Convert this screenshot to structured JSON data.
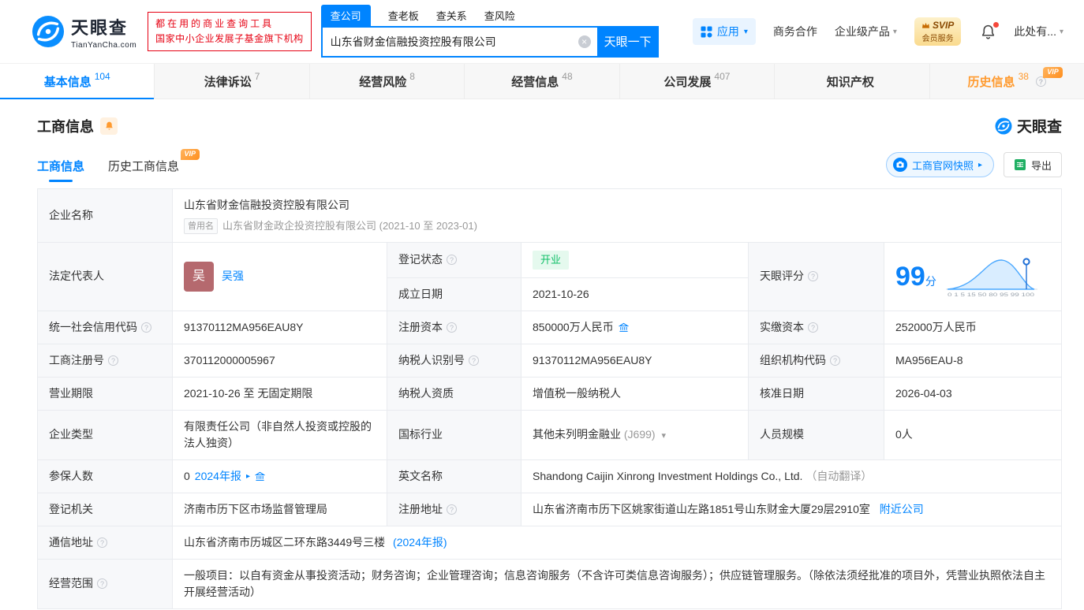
{
  "colors": {
    "brand": "#0084ff",
    "vip_orange": "#ff9a2e",
    "status_green": "#0fbf67",
    "status_green_bg": "#e5f9ee",
    "slogan_red": "#e60012",
    "avatar_bg": "#b5696e",
    "label_bg": "#f7f8fa",
    "table_border": "#e9ebef"
  },
  "icons": {
    "caret_down": "▾",
    "arrow_right": "▸",
    "clear": "×",
    "help": "?"
  },
  "header": {
    "logo_title": "天眼查",
    "logo_subtitle": "TianYanCha.com",
    "slogan_line1": "都在用的商业查询工具",
    "slogan_line2": "国家中小企业发展子基金旗下机构",
    "search_tabs": [
      {
        "label": "查公司"
      },
      {
        "label": "查老板"
      },
      {
        "label": "查关系"
      },
      {
        "label": "查风险"
      }
    ],
    "search_value": "山东省财金信融投资控股有限公司",
    "search_button": "天眼一下",
    "apps_label": "应用",
    "cooperation": "商务合作",
    "enterprise_product": "企业级产品",
    "svip_line1": "SVIP",
    "svip_line2": "会员服务",
    "more_label": "此处有..."
  },
  "nav_tabs": [
    {
      "label": "基本信息",
      "count": "104"
    },
    {
      "label": "法律诉讼",
      "count": "7"
    },
    {
      "label": "经营风险",
      "count": "8"
    },
    {
      "label": "经营信息",
      "count": "48"
    },
    {
      "label": "公司发展",
      "count": "407"
    },
    {
      "label": "知识产权",
      "count": ""
    },
    {
      "label": "历史信息",
      "count": "38",
      "vip": "VIP"
    }
  ],
  "section": {
    "title": "工商信息",
    "subtab_current": "工商信息",
    "subtab_history": "历史工商信息",
    "vip": "VIP",
    "snapshot_button": "工商官网快照",
    "export_button": "导出",
    "brand_mark": "天眼查"
  },
  "info": {
    "company_name": {
      "label": "企业名称",
      "value": "山东省财金信融投资控股有限公司",
      "former_tag": "曾用名",
      "former_value": "山东省财金政企投资控股有限公司 (2021-10 至 2023-01)"
    },
    "legal_rep": {
      "label": "法定代表人",
      "avatar": "吴",
      "name": "吴强"
    },
    "reg_status": {
      "label": "登记状态",
      "value": "开业"
    },
    "establish_date": {
      "label": "成立日期",
      "value": "2021-10-26"
    },
    "score": {
      "label": "天眼评分",
      "value": "99",
      "unit": "分",
      "axis": "0 1 5 15 50 80 95 99 100"
    },
    "credit_code": {
      "label": "统一社会信用代码",
      "value": "91370112MA956EAU8Y"
    },
    "reg_capital": {
      "label": "注册资本",
      "value": "850000万人民币"
    },
    "paid_capital": {
      "label": "实缴资本",
      "value": "252000万人民币"
    },
    "reg_number": {
      "label": "工商注册号",
      "value": "370112000005967"
    },
    "taxpayer_id": {
      "label": "纳税人识别号",
      "value": "91370112MA956EAU8Y"
    },
    "org_code": {
      "label": "组织机构代码",
      "value": "MA956EAU-8"
    },
    "business_term": {
      "label": "营业期限",
      "value": "2021-10-26 至 无固定期限"
    },
    "taxpayer_quality": {
      "label": "纳税人资质",
      "value": "增值税一般纳税人"
    },
    "approval_date": {
      "label": "核准日期",
      "value": "2026-04-03"
    },
    "company_type": {
      "label": "企业类型",
      "value": "有限责任公司（非自然人投资或控股的法人独资）"
    },
    "industry": {
      "label": "国标行业",
      "value": "其他未列明金融业",
      "code": "(J699)"
    },
    "staff_size": {
      "label": "人员规模",
      "value": "0人"
    },
    "insured": {
      "label": "参保人数",
      "value": "0",
      "report": "2024年报"
    },
    "english_name": {
      "label": "英文名称",
      "value": "Shandong Caijin Xinrong Investment Holdings Co., Ltd.",
      "note": "（自动翻译）"
    },
    "reg_authority": {
      "label": "登记机关",
      "value": "济南市历下区市场监督管理局"
    },
    "reg_address": {
      "label": "注册地址",
      "value": "山东省济南市历下区姚家街道山左路1851号山东财金大厦29层2910室",
      "link": "附近公司"
    },
    "mail_address": {
      "label": "通信地址",
      "value": "山东省济南市历城区二环东路3449号三楼",
      "report": "(2024年报)"
    },
    "business_scope": {
      "label": "经营范围",
      "value": "一般项目：以自有资金从事投资活动；财务咨询；企业管理咨询；信息咨询服务（不含许可类信息咨询服务）；供应链管理服务。（除依法须经批准的项目外，凭营业执照依法自主开展经营活动）"
    }
  }
}
